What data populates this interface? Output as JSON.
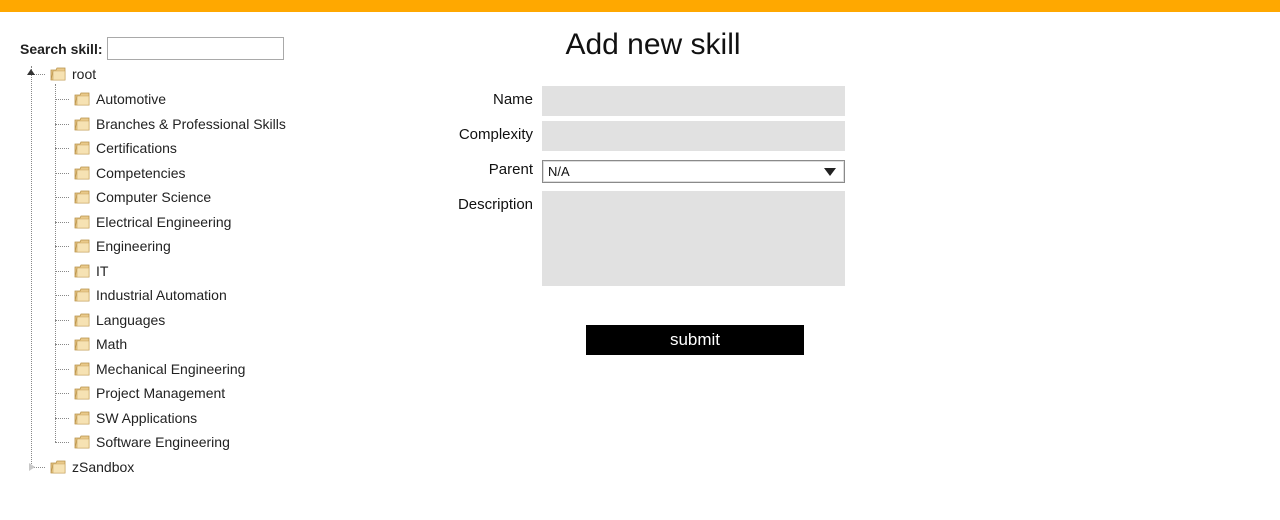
{
  "search": {
    "label": "Search skill:",
    "value": "",
    "placeholder": ""
  },
  "tree": {
    "root": {
      "label": "root",
      "state": "expanded",
      "children": [
        {
          "label": "Automotive"
        },
        {
          "label": "Branches & Professional Skills"
        },
        {
          "label": "Certifications"
        },
        {
          "label": "Competencies"
        },
        {
          "label": "Computer Science"
        },
        {
          "label": "Electrical Engineering"
        },
        {
          "label": "Engineering"
        },
        {
          "label": "IT"
        },
        {
          "label": "Industrial Automation"
        },
        {
          "label": "Languages"
        },
        {
          "label": "Math"
        },
        {
          "label": "Mechanical Engineering"
        },
        {
          "label": "Project Management"
        },
        {
          "label": "SW Applications"
        },
        {
          "label": "Software Engineering"
        }
      ]
    },
    "sandbox": {
      "label": "zSandbox",
      "state": "collapsed"
    },
    "icons": {
      "folder": "folder-icon"
    }
  },
  "form": {
    "title": "Add new skill",
    "name_label": "Name",
    "name_value": "",
    "complexity_label": "Complexity",
    "complexity_value": "",
    "parent_label": "Parent",
    "parent_value": "N/A",
    "description_label": "Description",
    "description_value": "",
    "submit_label": "submit"
  },
  "colors": {
    "accent_bar": "#ffa800",
    "input_bg": "#e1e1e1",
    "button_bg": "#000000"
  }
}
